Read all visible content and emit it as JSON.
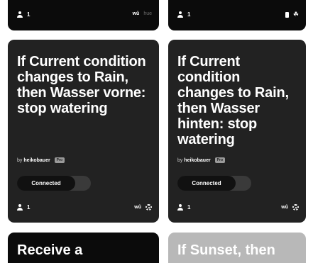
{
  "cards": {
    "top_left": {
      "users_count": "1",
      "service_text": "wû",
      "service_text_2": "hue"
    },
    "top_right": {
      "users_count": "1",
      "icons": [
        "phone-icon",
        "share-icon"
      ]
    },
    "left": {
      "title": "If Current condition changes to Rain, then Wasser vorne: stop watering",
      "by": "by",
      "author": "heikobauer",
      "badge": "Pro",
      "status": "Connected",
      "users_count": "1",
      "service_text": "wû",
      "service_icon": "gear-icon"
    },
    "right": {
      "title": "If Current condition changes to Rain, then Wasser hinten: stop watering",
      "by": "by",
      "author": "heikobauer",
      "badge": "Pro",
      "status": "Connected",
      "users_count": "1",
      "service_text": "wû",
      "service_icon": "gear-icon"
    },
    "bottom_left": {
      "title": "Receive a"
    },
    "bottom_right": {
      "title": "If Sunset, then"
    }
  },
  "colors": {
    "card": "#222222",
    "card_black": "#0b0b0b",
    "card_grey": "#b8b8b8",
    "text": "#ffffff",
    "toggle_track": "#3a3a3a",
    "toggle_knob": "#111111"
  }
}
